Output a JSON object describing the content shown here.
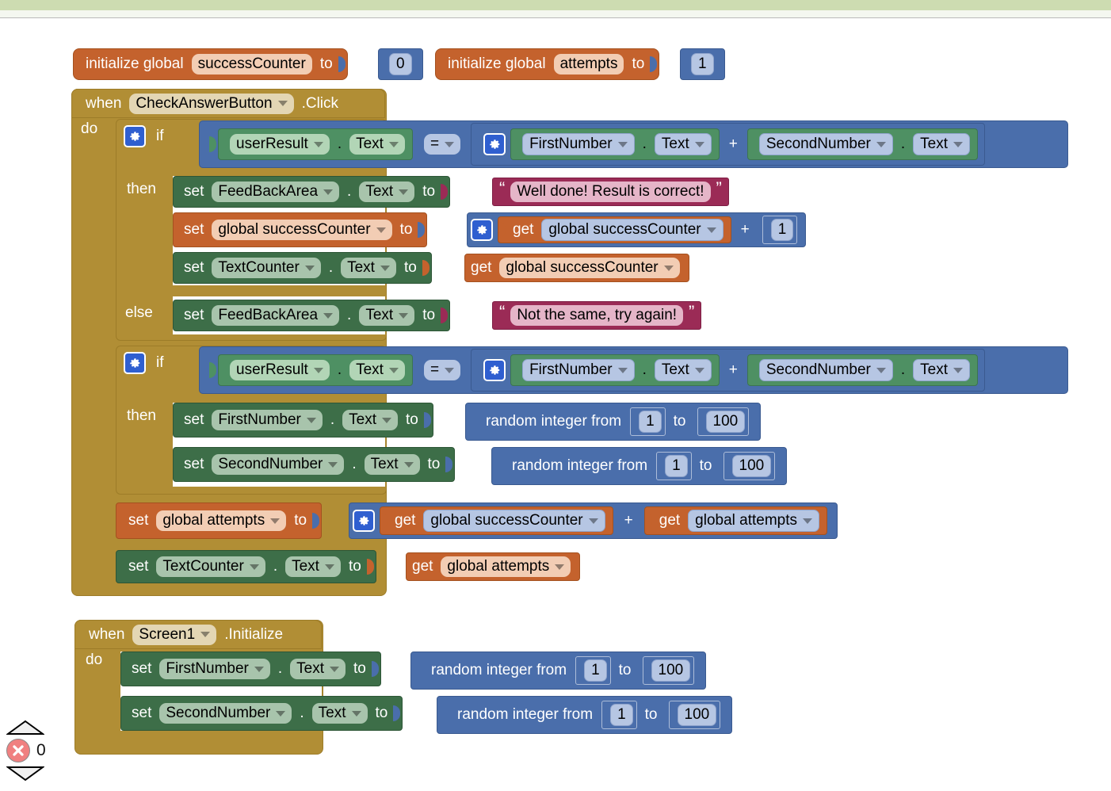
{
  "editor": {
    "name": "MIT App Inventor Blocks Editor",
    "warning_indicator": {
      "up_arrow": "collapse-warnings",
      "error_icon": "error-x-icon",
      "error_count": "0",
      "down_arrow": "expand-warnings"
    }
  },
  "globals": [
    {
      "prefix": "initialize global",
      "name": "successCounter",
      "to_label": "to",
      "value": "0"
    },
    {
      "prefix": "initialize global",
      "name": "attempts",
      "to_label": "to",
      "value": "1"
    }
  ],
  "events": [
    {
      "when": "when",
      "component": "CheckAnswerButton",
      "event": ".Click",
      "do_label": "do",
      "statements": {
        "if1": {
          "if_label": "if",
          "then_label": "then",
          "else_label": "else",
          "condition": {
            "left": {
              "component": "userResult",
              "property": "Text",
              "dot": "."
            },
            "operator": "=",
            "right": {
              "left": {
                "component": "FirstNumber",
                "property": "Text",
                "dot": "."
              },
              "operator": "+",
              "right": {
                "component": "SecondNumber",
                "property": "Text",
                "dot": "."
              }
            }
          },
          "then": [
            {
              "set": "set",
              "component": "FeedBackArea",
              "property": "Text",
              "dot": ".",
              "to": "to",
              "value_text": "Well done! Result is correct!",
              "open_quote": "“",
              "close_quote": "”"
            },
            {
              "set": "set",
              "variable": "global successCounter",
              "to": "to",
              "expr": {
                "get": "get",
                "variable": "global successCounter",
                "operator": "+",
                "number": "1"
              }
            },
            {
              "set": "set",
              "component": "TextCounter",
              "property": "Text",
              "dot": ".",
              "to": "to",
              "get": "get",
              "variable": "global successCounter"
            }
          ],
          "else": [
            {
              "set": "set",
              "component": "FeedBackArea",
              "property": "Text",
              "dot": ".",
              "to": "to",
              "value_text": "Not the same, try again!",
              "open_quote": "“",
              "close_quote": "”"
            }
          ]
        },
        "if2": {
          "if_label": "if",
          "then_label": "then",
          "condition": {
            "left": {
              "component": "userResult",
              "property": "Text",
              "dot": "."
            },
            "operator": "=",
            "right": {
              "left": {
                "component": "FirstNumber",
                "property": "Text",
                "dot": "."
              },
              "operator": "+",
              "right": {
                "component": "SecondNumber",
                "property": "Text",
                "dot": "."
              }
            }
          },
          "then": [
            {
              "set": "set",
              "component": "FirstNumber",
              "property": "Text",
              "dot": ".",
              "to": "to",
              "random": {
                "label": "random integer from",
                "from": "1",
                "to_label": "to",
                "to": "100"
              }
            },
            {
              "set": "set",
              "component": "SecondNumber",
              "property": "Text",
              "dot": ".",
              "to": "to",
              "random": {
                "label": "random integer from",
                "from": "1",
                "to_label": "to",
                "to": "100"
              }
            }
          ]
        },
        "set_attempts": {
          "set": "set",
          "variable": "global attempts",
          "to": "to",
          "expr": {
            "get_left": "get",
            "var_left": "global successCounter",
            "operator": "+",
            "get_right": "get",
            "var_right": "global attempts"
          }
        },
        "set_textcounter": {
          "set": "set",
          "component": "TextCounter",
          "property": "Text",
          "dot": ".",
          "to": "to",
          "get": "get",
          "variable": "global attempts"
        }
      }
    },
    {
      "when": "when",
      "component": "Screen1",
      "event": ".Initialize",
      "do_label": "do",
      "statements": [
        {
          "set": "set",
          "component": "FirstNumber",
          "property": "Text",
          "dot": ".",
          "to": "to",
          "random": {
            "label": "random integer from",
            "from": "1",
            "to_label": "to",
            "to": "100"
          }
        },
        {
          "set": "set",
          "component": "SecondNumber",
          "property": "Text",
          "dot": ".",
          "to": "to",
          "random": {
            "label": "random integer from",
            "from": "1",
            "to_label": "to",
            "to": "100"
          }
        }
      ]
    }
  ],
  "colors": {
    "event_block": "#b18e35",
    "control_block": "#b18e35",
    "component_set": "#3d6e48",
    "component_get": "#4e9063",
    "variable_block": "#c4622d",
    "math_logic_block": "#4a6eab",
    "text_block": "#9b2b56",
    "canvas_background": "#ffffff",
    "toolbar_green": "#cddcb1"
  }
}
